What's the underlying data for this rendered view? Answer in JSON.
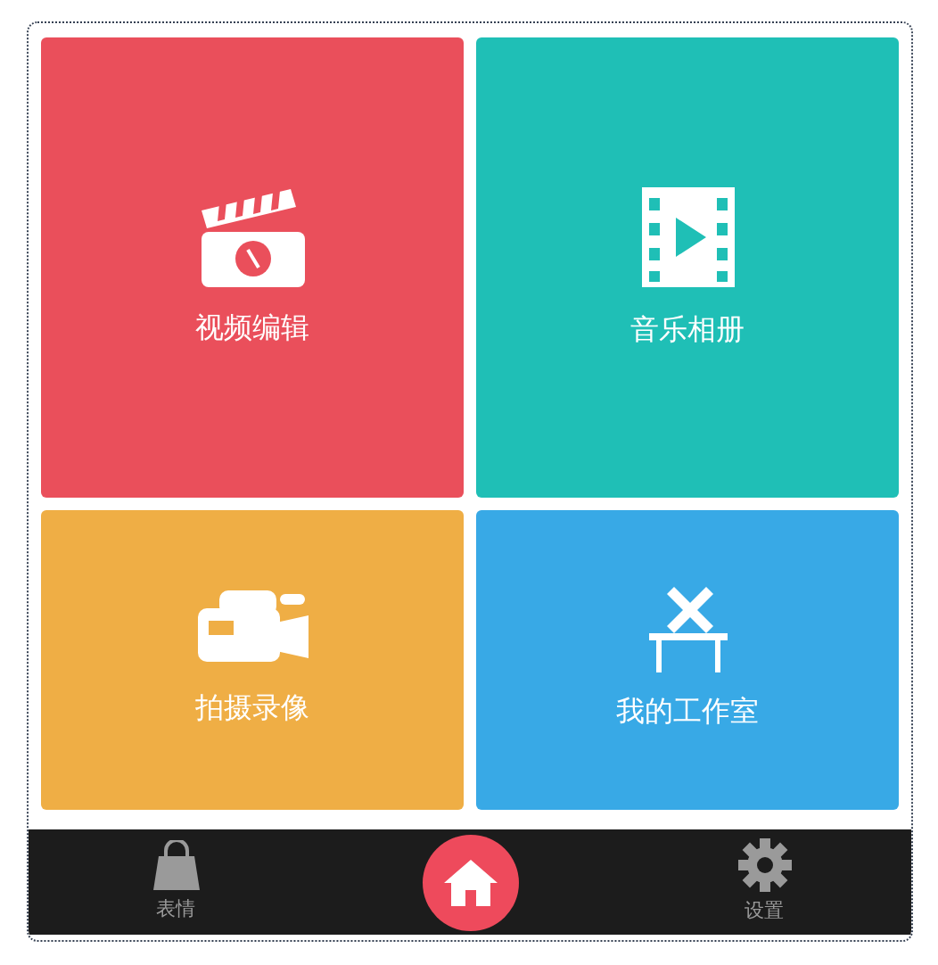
{
  "tiles": [
    {
      "label": "视频编辑",
      "kind": "clapper",
      "color": "#ea4f5b"
    },
    {
      "label": "音乐相册",
      "kind": "film",
      "color": "#1fbfb6"
    },
    {
      "label": "拍摄录像",
      "kind": "camera",
      "color": "#efae45"
    },
    {
      "label": "我的工作室",
      "kind": "desk",
      "color": "#38a9e6"
    }
  ],
  "nav": [
    {
      "label": "表情",
      "kind": "bag",
      "selected": false
    },
    {
      "kind": "home",
      "selected": true
    },
    {
      "label": "设置",
      "kind": "gear",
      "selected": false
    }
  ]
}
